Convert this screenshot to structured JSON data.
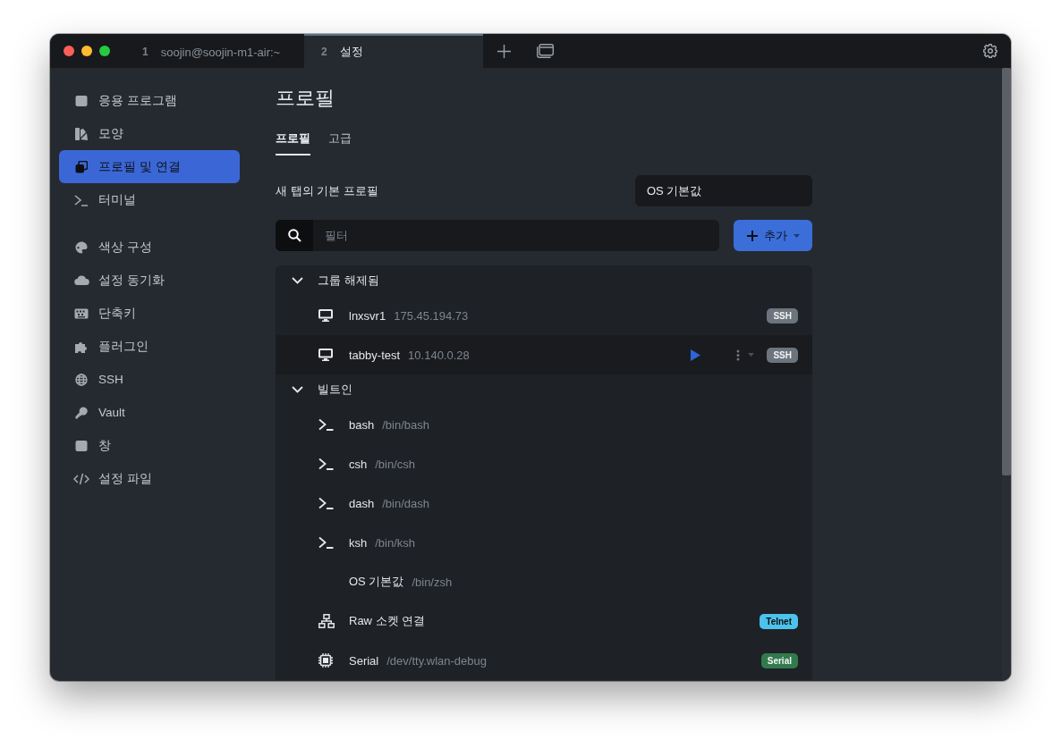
{
  "tabs": [
    {
      "number": "1",
      "title": "soojin@soojin-m1-air:~",
      "selected": false
    },
    {
      "number": "2",
      "title": "설정",
      "selected": true
    }
  ],
  "sidebar": {
    "groups": [
      [
        {
          "label": "응용 프로그램",
          "selected": false
        },
        {
          "label": "모양",
          "selected": false
        },
        {
          "label": "프로필 및 연결",
          "selected": true
        },
        {
          "label": "터미널",
          "selected": false
        }
      ],
      [
        {
          "label": "색상 구성",
          "selected": false
        },
        {
          "label": "설정 동기화",
          "selected": false
        },
        {
          "label": "단축키",
          "selected": false
        },
        {
          "label": "플러그인",
          "selected": false
        },
        {
          "label": "SSH",
          "selected": false
        },
        {
          "label": "Vault",
          "selected": false
        },
        {
          "label": "창",
          "selected": false
        },
        {
          "label": "설정 파일",
          "selected": false
        }
      ]
    ]
  },
  "page": {
    "title": "프로필",
    "subtabs": [
      {
        "label": "프로필",
        "selected": true
      },
      {
        "label": "고급",
        "selected": false
      }
    ],
    "default_profile": {
      "label": "새 탭의 기본 프로필",
      "value": "OS 기본값"
    },
    "filter": {
      "placeholder": "필터"
    },
    "add_button": "추가",
    "groups": [
      {
        "name": "그룹 해제됨",
        "expanded": true,
        "profiles": [
          {
            "kind": "ssh",
            "name": "lnxsvr1",
            "detail": "175.45.194.73",
            "badge": "SSH",
            "color": "#6c747d",
            "hovered": false
          },
          {
            "kind": "ssh",
            "name": "tabby-test",
            "detail": "10.140.0.28",
            "badge": "SSH",
            "color": "#6c747d",
            "hovered": true
          }
        ]
      },
      {
        "name": "빌트인",
        "expanded": true,
        "profiles": [
          {
            "kind": "shell",
            "name": "bash",
            "detail": "/bin/bash",
            "hovered": false
          },
          {
            "kind": "shell",
            "name": "csh",
            "detail": "/bin/csh",
            "hovered": false
          },
          {
            "kind": "shell",
            "name": "dash",
            "detail": "/bin/dash",
            "hovered": false
          },
          {
            "kind": "shell",
            "name": "ksh",
            "detail": "/bin/ksh",
            "hovered": false
          },
          {
            "kind": "default",
            "name": "OS 기본값",
            "detail": "/bin/zsh",
            "hovered": false
          },
          {
            "kind": "telnet",
            "name": "Raw 소켓 연결",
            "badge": "Telnet",
            "color": "#4cc3ec",
            "hovered": false
          },
          {
            "kind": "serial",
            "name": "Serial",
            "detail": "/dev/tty.wlan-debug",
            "badge": "Serial",
            "color": "#327a4c",
            "hovered": false
          }
        ]
      }
    ]
  }
}
